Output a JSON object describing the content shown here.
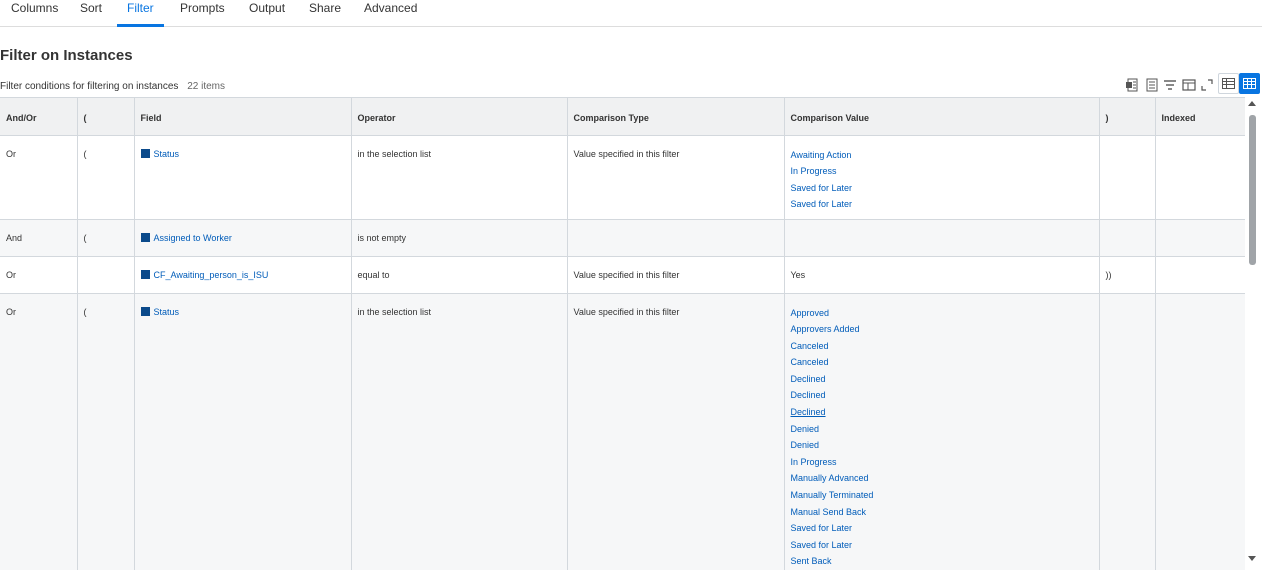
{
  "tabs": [
    {
      "label": "Columns"
    },
    {
      "label": "Sort"
    },
    {
      "label": "Filter"
    },
    {
      "label": "Prompts"
    },
    {
      "label": "Output"
    },
    {
      "label": "Share"
    },
    {
      "label": "Advanced"
    }
  ],
  "active_tab": "Filter",
  "accent_color": "#0875e1",
  "page_title": "Filter on Instances",
  "subtitle": {
    "text": "Filter conditions for filtering on instances",
    "count": "22 items"
  },
  "toolbar_icons": [
    "export-excel-icon",
    "export-pdf-icon",
    "filter-icon",
    "columns-icon",
    "fullscreen-icon",
    "grid-view-icon",
    "table-view-icon"
  ],
  "table": {
    "headers": [
      "And/Or",
      "(",
      "Field",
      "Operator",
      "Comparison Type",
      "Comparison Value",
      ")",
      "Indexed"
    ],
    "rows": [
      {
        "and_or": "Or",
        "open_paren": "(",
        "field": "Status",
        "operator": "in the selection list",
        "comparison_type": "Value specified in this filter",
        "values": [
          "Awaiting Action",
          "In Progress",
          "Saved for Later",
          "Saved for Later"
        ],
        "close_paren": "",
        "indexed": ""
      },
      {
        "and_or": "And",
        "open_paren": "(",
        "field": "Assigned to Worker",
        "operator": "is not empty",
        "comparison_type": "",
        "values": [],
        "close_paren": "",
        "indexed": ""
      },
      {
        "and_or": "Or",
        "open_paren": "",
        "field": "CF_Awaiting_person_is_ISU",
        "operator": "equal to",
        "comparison_type": "Value specified in this filter",
        "plain_value": "Yes",
        "close_paren": "))",
        "indexed": ""
      },
      {
        "and_or": "Or",
        "open_paren": "(",
        "field": "Status",
        "operator": "in the selection list",
        "comparison_type": "Value specified in this filter",
        "values": [
          "Approved",
          "Approvers Added",
          "Canceled",
          "Canceled",
          "Declined",
          "Declined",
          "Declined",
          "Denied",
          "Denied",
          "In Progress",
          "Manually Advanced",
          "Manually Terminated",
          "Manual Send Back",
          "Saved for Later",
          "Saved for Later",
          "Sent Back"
        ],
        "close_paren": "",
        "indexed": ""
      }
    ]
  }
}
